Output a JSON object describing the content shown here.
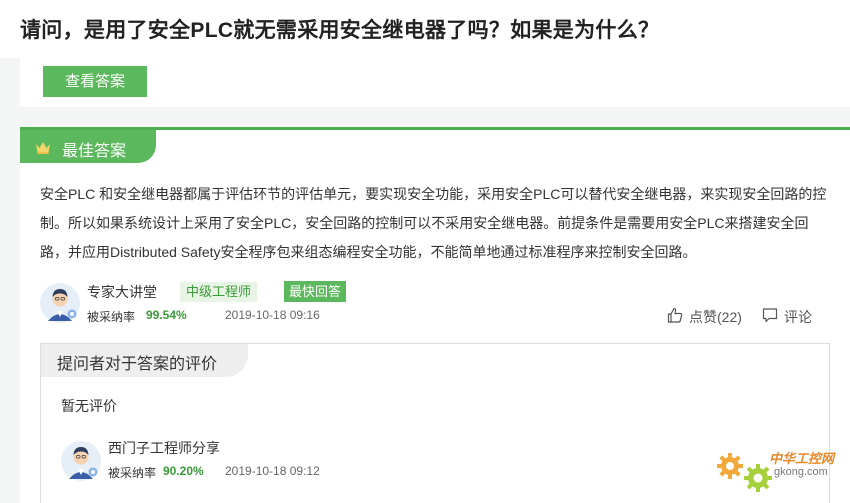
{
  "question": {
    "title": "请问，是用了安全PLC就无需采用安全继电器了吗？如果是为什么？"
  },
  "answer_strip": {
    "view_answer_label": "查看答案"
  },
  "best_answer": {
    "tab_label": "最佳答案",
    "tab_icon": "crown-icon",
    "body": "安全PLC 和安全继电器都属于评估环节的评估单元，要实现安全功能，采用安全PLC可以替代安全继电器，来实现安全回路的控制。所以如果系统设计上采用了安全PLC，安全回路的控制可以不采用安全继电器。前提条件是需要用安全PLC来搭建安全回路，并应用Distributed Safety安全程序包来组态编程安全功能，不能简单地通过标准程序来控制安全回路。",
    "answerer": {
      "name": "专家大讲堂",
      "level_badge": "中级工程师",
      "fast_badge": "最快回答",
      "adoption_label": "被采纳率",
      "adoption_rate": "99.54%",
      "time": "2019-10-18 09:16"
    },
    "actions": {
      "like_label": "点赞(22)",
      "like_icon": "thumbs-up-icon",
      "comment_label": "评论",
      "comment_icon": "comment-icon"
    }
  },
  "evaluation": {
    "tab_label": "提问者对于答案的评价",
    "empty_text": "暂无评价",
    "asker": {
      "name": "西门子工程师分享",
      "adoption_label": "被采纳率",
      "adoption_rate": "90.20%",
      "time": "2019-10-18 09:12"
    }
  },
  "watermark": {
    "name_cn": "中华工控网",
    "domain": "gkong.com"
  },
  "colors": {
    "accent_green": "#5cb85c",
    "rate_green": "#3a9b3a",
    "watermark_orange": "#e8892a"
  }
}
